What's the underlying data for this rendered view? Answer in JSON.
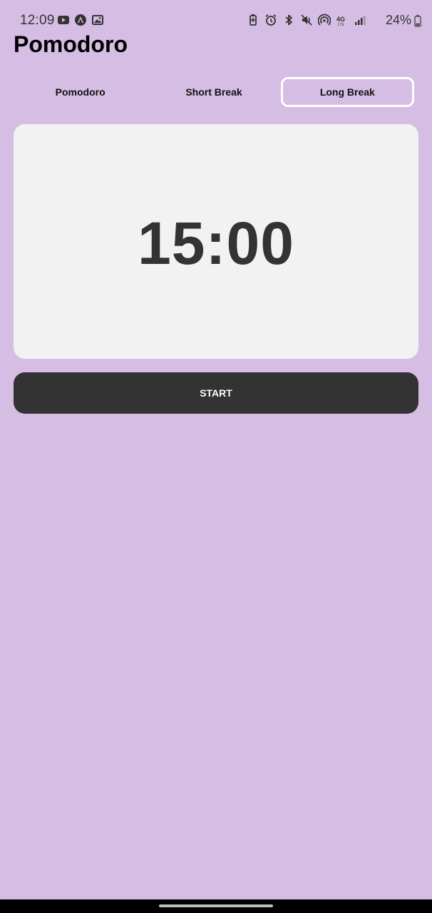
{
  "status_bar": {
    "time": "12:09",
    "battery": "24%",
    "left_icons": [
      "youtube-icon",
      "app-a-icon",
      "gallery-icon"
    ],
    "right_icons": [
      "battery-saver-icon",
      "alarm-icon",
      "bluetooth-icon",
      "mute-icon",
      "hotspot-icon",
      "4g-lte-icon",
      "signal-icon"
    ]
  },
  "app": {
    "title": "Pomodoro"
  },
  "tabs": [
    {
      "label": "Pomodoro",
      "active": false
    },
    {
      "label": "Short Break",
      "active": false
    },
    {
      "label": "Long Break",
      "active": true
    }
  ],
  "timer": {
    "display": "15:00"
  },
  "controls": {
    "start_label": "START"
  },
  "colors": {
    "background": "#d6bde3",
    "card": "#f2f2f2",
    "button": "#333333",
    "active_tab_border": "#ffffff"
  }
}
